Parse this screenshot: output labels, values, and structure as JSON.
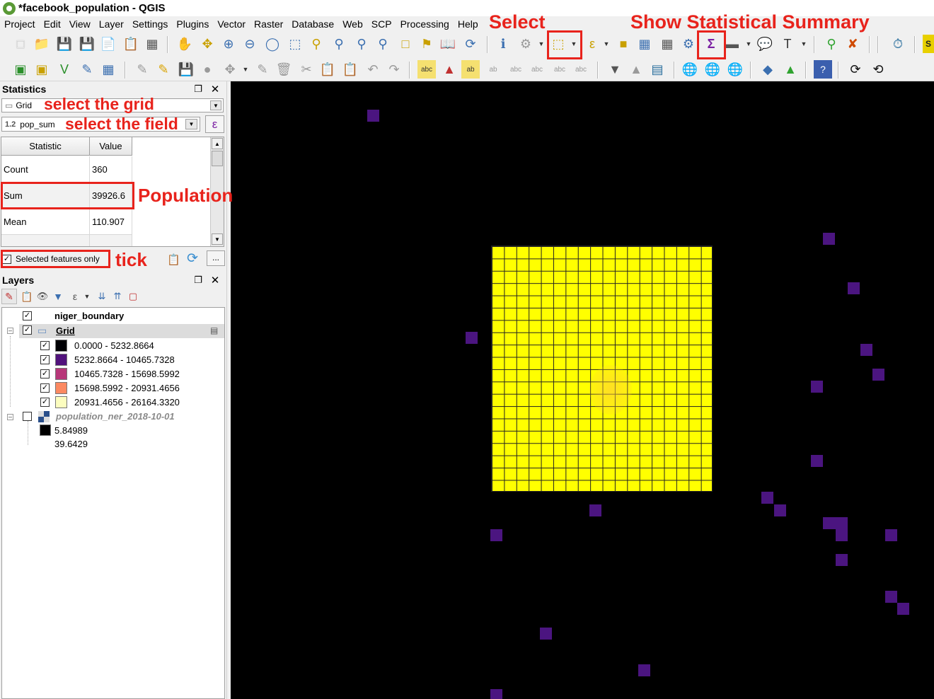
{
  "window": {
    "title": "*facebook_population - QGIS"
  },
  "menu": [
    "Project",
    "Edit",
    "View",
    "Layer",
    "Settings",
    "Plugins",
    "Vector",
    "Raster",
    "Database",
    "Web",
    "SCP",
    "Processing",
    "Help"
  ],
  "statistics_panel": {
    "title": "Statistics",
    "layer_combo": "Grid",
    "field_type": "1.2",
    "field_combo": "pop_sum",
    "table": {
      "headers": [
        "Statistic",
        "Value"
      ],
      "rows": [
        {
          "stat": "Count",
          "value": "360"
        },
        {
          "stat": "Sum",
          "value": "39926.6"
        },
        {
          "stat": "Mean",
          "value": "110.907"
        }
      ]
    },
    "selected_only_label": "Selected features only",
    "selected_only_checked": true,
    "more_button": "..."
  },
  "layers_panel": {
    "title": "Layers",
    "layers": {
      "boundary": "niger_boundary",
      "grid": "Grid",
      "raster": "population_ner_2018-10-01"
    },
    "grid_classes": [
      {
        "label": "0.0000 - 5232.8664",
        "color": "#000004"
      },
      {
        "label": "5232.8664 - 10465.7328",
        "color": "#51127c"
      },
      {
        "label": "10465.7328 - 15698.5992",
        "color": "#b73779"
      },
      {
        "label": "15698.5992 - 20931.4656",
        "color": "#fc8961"
      },
      {
        "label": "20931.4656 - 26164.3320",
        "color": "#fcfdbf"
      }
    ],
    "raster_legend": {
      "max": "5.84989",
      "min": "39.6429"
    }
  },
  "annotations": {
    "select": "Select",
    "summary": "Show Statistical Summary",
    "grid": "select the grid",
    "field": "select the field",
    "population": "Population",
    "tick": "tick"
  },
  "colors": {
    "annotation": "#e8231c",
    "selected_fill": "#ffff00",
    "cell_purple": "#4b1580"
  }
}
